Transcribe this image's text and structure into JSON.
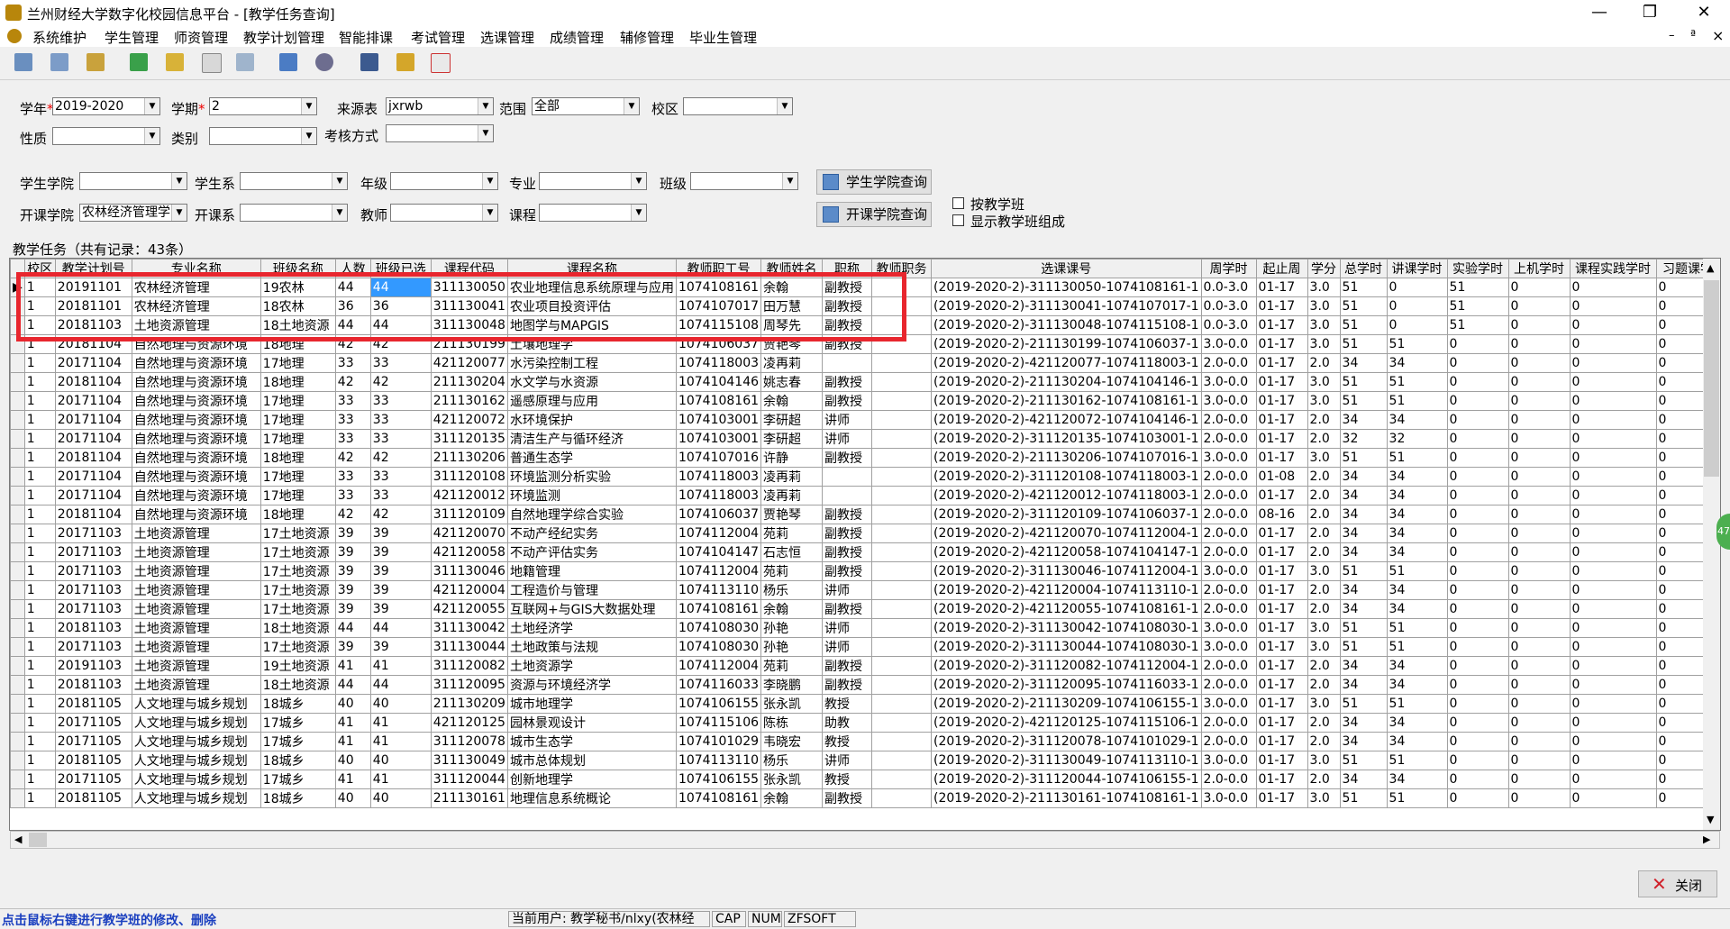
{
  "window": {
    "title": "兰州财经大学数字化校园信息平台 - [教学任务查询]",
    "min": "—",
    "max": "❐",
    "close": "✕"
  },
  "menu": [
    "系统维护",
    "学生管理",
    "师资管理",
    "教学计划管理",
    "智能排课",
    "考试管理",
    "选课管理",
    "成绩管理",
    "辅修管理",
    "毕业生管理"
  ],
  "mdi": {
    "min": "–",
    "restore": "ª",
    "close": "×"
  },
  "filters": {
    "xuenian_label": "学年",
    "xuenian_value": "2019-2020",
    "xueqi_label": "学期",
    "xueqi_value": "2",
    "laiyuan_label": "来源表",
    "laiyuan_value": "jxrwb",
    "fanwei_label": "范围",
    "fanwei_value": "全部",
    "xiaoqu_label": "校区",
    "xingzhi_label": "性质",
    "leibie_label": "类别",
    "kaohe_label": "考核方式",
    "xsxy_label": "学生学院",
    "xsx_label": "学生系",
    "nianji_label": "年级",
    "zhuanye_label": "专业",
    "banji_label": "班级",
    "kkxy_label": "开课学院",
    "kkxy_value": "农林经济管理学",
    "kkx_label": "开课系",
    "jiaoshi_label": "教师",
    "kecheng_label": "课程",
    "btn_student_query": "学生学院查询",
    "btn_course_query": "开课学院查询",
    "chk_by_class": "按教学班",
    "chk_show_compose": "显示教学班组成"
  },
  "grid": {
    "title": "教学任务（共有记录：43条）",
    "columns": [
      "校区",
      "教学计划号",
      "专业名称",
      "班级名称",
      "人数",
      "班级已选",
      "课程代码",
      "课程名称",
      "教师职工号",
      "教师姓名",
      "职称",
      "教师职务",
      "选课课号",
      "周学时",
      "起止周",
      "学分",
      "总学时",
      "讲课学时",
      "实验学时",
      "上机学时",
      "课程实践学时",
      "习题课学"
    ],
    "rows": [
      [
        "1",
        "20191101",
        "农林经济管理",
        "19农林",
        "44",
        "44",
        "311130050",
        "农业地理信息系统原理与应用",
        "1074108161",
        "余翰",
        "副教授",
        "",
        "(2019-2020-2)-311130050-1074108161-1",
        "0.0-3.0",
        "01-17",
        "3.0",
        "51",
        "0",
        "51",
        "0",
        "0",
        "0"
      ],
      [
        "1",
        "20181101",
        "农林经济管理",
        "18农林",
        "36",
        "36",
        "311130041",
        "农业项目投资评估",
        "1074107017",
        "田万慧",
        "副教授",
        "",
        "(2019-2020-2)-311130041-1074107017-1",
        "0.0-3.0",
        "01-17",
        "3.0",
        "51",
        "0",
        "51",
        "0",
        "0",
        "0"
      ],
      [
        "1",
        "20181103",
        "土地资源管理",
        "18土地资源",
        "44",
        "44",
        "311130048",
        "地图学与MAPGIS",
        "1074115108",
        "周琴先",
        "副教授",
        "",
        "(2019-2020-2)-311130048-1074115108-1",
        "0.0-3.0",
        "01-17",
        "3.0",
        "51",
        "0",
        "51",
        "0",
        "0",
        "0"
      ],
      [
        "1",
        "20181104",
        "自然地理与资源环境",
        "18地理",
        "42",
        "42",
        "211130199",
        "土壤地理学",
        "1074106037",
        "贾艳琴",
        "副教授",
        "",
        "(2019-2020-2)-211130199-1074106037-1",
        "3.0-0.0",
        "01-17",
        "3.0",
        "51",
        "51",
        "0",
        "0",
        "0",
        "0"
      ],
      [
        "1",
        "20171104",
        "自然地理与资源环境",
        "17地理",
        "33",
        "33",
        "421120077",
        "水污染控制工程",
        "1074118003",
        "凌再莉",
        "",
        "",
        "(2019-2020-2)-421120077-1074118003-1",
        "2.0-0.0",
        "01-17",
        "2.0",
        "34",
        "34",
        "0",
        "0",
        "0",
        "0"
      ],
      [
        "1",
        "20181104",
        "自然地理与资源环境",
        "18地理",
        "42",
        "42",
        "211130204",
        "水文学与水资源",
        "1074104146",
        "姚志春",
        "副教授",
        "",
        "(2019-2020-2)-211130204-1074104146-1",
        "3.0-0.0",
        "01-17",
        "3.0",
        "51",
        "51",
        "0",
        "0",
        "0",
        "0"
      ],
      [
        "1",
        "20171104",
        "自然地理与资源环境",
        "17地理",
        "33",
        "33",
        "211130162",
        "遥感原理与应用",
        "1074108161",
        "余翰",
        "副教授",
        "",
        "(2019-2020-2)-211130162-1074108161-1",
        "3.0-0.0",
        "01-17",
        "3.0",
        "51",
        "51",
        "0",
        "0",
        "0",
        "0"
      ],
      [
        "1",
        "20171104",
        "自然地理与资源环境",
        "17地理",
        "33",
        "33",
        "421120072",
        "水环境保护",
        "1074103001",
        "李研超",
        "讲师",
        "",
        "(2019-2020-2)-421120072-1074104146-1",
        "2.0-0.0",
        "01-17",
        "2.0",
        "34",
        "34",
        "0",
        "0",
        "0",
        "0"
      ],
      [
        "1",
        "20171104",
        "自然地理与资源环境",
        "17地理",
        "33",
        "33",
        "311120135",
        "清洁生产与循环经济",
        "1074103001",
        "李研超",
        "讲师",
        "",
        "(2019-2020-2)-311120135-1074103001-1",
        "2.0-0.0",
        "01-17",
        "2.0",
        "32",
        "32",
        "0",
        "0",
        "0",
        "0"
      ],
      [
        "1",
        "20181104",
        "自然地理与资源环境",
        "18地理",
        "42",
        "42",
        "211130206",
        "普通生态学",
        "1074107016",
        "许静",
        "副教授",
        "",
        "(2019-2020-2)-211130206-1074107016-1",
        "3.0-0.0",
        "01-17",
        "3.0",
        "51",
        "51",
        "0",
        "0",
        "0",
        "0"
      ],
      [
        "1",
        "20171104",
        "自然地理与资源环境",
        "17地理",
        "33",
        "33",
        "311120108",
        "环境监测分析实验",
        "1074118003",
        "凌再莉",
        "",
        "",
        "(2019-2020-2)-311120108-1074118003-1",
        "2.0-0.0",
        "01-08",
        "2.0",
        "34",
        "34",
        "0",
        "0",
        "0",
        "0"
      ],
      [
        "1",
        "20171104",
        "自然地理与资源环境",
        "17地理",
        "33",
        "33",
        "421120012",
        "环境监测",
        "1074118003",
        "凌再莉",
        "",
        "",
        "(2019-2020-2)-421120012-1074118003-1",
        "2.0-0.0",
        "01-17",
        "2.0",
        "34",
        "34",
        "0",
        "0",
        "0",
        "0"
      ],
      [
        "1",
        "20181104",
        "自然地理与资源环境",
        "18地理",
        "42",
        "42",
        "311120109",
        "自然地理学综合实验",
        "1074106037",
        "贾艳琴",
        "副教授",
        "",
        "(2019-2020-2)-311120109-1074106037-1",
        "2.0-0.0",
        "08-16",
        "2.0",
        "34",
        "34",
        "0",
        "0",
        "0",
        "0"
      ],
      [
        "1",
        "20171103",
        "土地资源管理",
        "17土地资源",
        "39",
        "39",
        "421120070",
        "不动产经纪实务",
        "1074112004",
        "苑莉",
        "副教授",
        "",
        "(2019-2020-2)-421120070-1074112004-1",
        "2.0-0.0",
        "01-17",
        "2.0",
        "34",
        "34",
        "0",
        "0",
        "0",
        "0"
      ],
      [
        "1",
        "20171103",
        "土地资源管理",
        "17土地资源",
        "39",
        "39",
        "421120058",
        "不动产评估实务",
        "1074104147",
        "石志恒",
        "副教授",
        "",
        "(2019-2020-2)-421120058-1074104147-1",
        "2.0-0.0",
        "01-17",
        "2.0",
        "34",
        "34",
        "0",
        "0",
        "0",
        "0"
      ],
      [
        "1",
        "20171103",
        "土地资源管理",
        "17土地资源",
        "39",
        "39",
        "311130046",
        "地籍管理",
        "1074112004",
        "苑莉",
        "副教授",
        "",
        "(2019-2020-2)-311130046-1074112004-1",
        "3.0-0.0",
        "01-17",
        "3.0",
        "51",
        "51",
        "0",
        "0",
        "0",
        "0"
      ],
      [
        "1",
        "20171103",
        "土地资源管理",
        "17土地资源",
        "39",
        "39",
        "421120004",
        "工程造价与管理",
        "1074113110",
        "杨乐",
        "讲师",
        "",
        "(2019-2020-2)-421120004-1074113110-1",
        "2.0-0.0",
        "01-17",
        "2.0",
        "34",
        "34",
        "0",
        "0",
        "0",
        "0"
      ],
      [
        "1",
        "20171103",
        "土地资源管理",
        "17土地资源",
        "39",
        "39",
        "421120055",
        "互联网+与GIS大数据处理",
        "1074108161",
        "余翰",
        "副教授",
        "",
        "(2019-2020-2)-421120055-1074108161-1",
        "2.0-0.0",
        "01-17",
        "2.0",
        "34",
        "34",
        "0",
        "0",
        "0",
        "0"
      ],
      [
        "1",
        "20181103",
        "土地资源管理",
        "18土地资源",
        "44",
        "44",
        "311130042",
        "土地经济学",
        "1074108030",
        "孙艳",
        "讲师",
        "",
        "(2019-2020-2)-311130042-1074108030-1",
        "3.0-0.0",
        "01-17",
        "3.0",
        "51",
        "51",
        "0",
        "0",
        "0",
        "0"
      ],
      [
        "1",
        "20171103",
        "土地资源管理",
        "17土地资源",
        "39",
        "39",
        "311130044",
        "土地政策与法规",
        "1074108030",
        "孙艳",
        "讲师",
        "",
        "(2019-2020-2)-311130044-1074108030-1",
        "3.0-0.0",
        "01-17",
        "3.0",
        "51",
        "51",
        "0",
        "0",
        "0",
        "0"
      ],
      [
        "1",
        "20191103",
        "土地资源管理",
        "19土地资源",
        "41",
        "41",
        "311120082",
        "土地资源学",
        "1074112004",
        "苑莉",
        "副教授",
        "",
        "(2019-2020-2)-311120082-1074112004-1",
        "2.0-0.0",
        "01-17",
        "2.0",
        "34",
        "34",
        "0",
        "0",
        "0",
        "0"
      ],
      [
        "1",
        "20181103",
        "土地资源管理",
        "18土地资源",
        "44",
        "44",
        "311120095",
        "资源与环境经济学",
        "1074116033",
        "李晓鹏",
        "副教授",
        "",
        "(2019-2020-2)-311120095-1074116033-1",
        "2.0-0.0",
        "01-17",
        "2.0",
        "34",
        "34",
        "0",
        "0",
        "0",
        "0"
      ],
      [
        "1",
        "20181105",
        "人文地理与城乡规划",
        "18城乡",
        "40",
        "40",
        "211130209",
        "城市地理学",
        "1074106155",
        "张永凯",
        "教授",
        "",
        "(2019-2020-2)-211130209-1074106155-1",
        "3.0-0.0",
        "01-17",
        "3.0",
        "51",
        "51",
        "0",
        "0",
        "0",
        "0"
      ],
      [
        "1",
        "20171105",
        "人文地理与城乡规划",
        "17城乡",
        "41",
        "41",
        "421120125",
        "园林景观设计",
        "1074115106",
        "陈栋",
        "助教",
        "",
        "(2019-2020-2)-421120125-1074115106-1",
        "2.0-0.0",
        "01-17",
        "2.0",
        "34",
        "34",
        "0",
        "0",
        "0",
        "0"
      ],
      [
        "1",
        "20171105",
        "人文地理与城乡规划",
        "17城乡",
        "41",
        "41",
        "311120078",
        "城市生态学",
        "1074101029",
        "韦晓宏",
        "教授",
        "",
        "(2019-2020-2)-311120078-1074101029-1",
        "2.0-0.0",
        "01-17",
        "2.0",
        "34",
        "34",
        "0",
        "0",
        "0",
        "0"
      ],
      [
        "1",
        "20181105",
        "人文地理与城乡规划",
        "18城乡",
        "40",
        "40",
        "311130049",
        "城市总体规划",
        "1074113110",
        "杨乐",
        "讲师",
        "",
        "(2019-2020-2)-311130049-1074113110-1",
        "3.0-0.0",
        "01-17",
        "3.0",
        "51",
        "51",
        "0",
        "0",
        "0",
        "0"
      ],
      [
        "1",
        "20171105",
        "人文地理与城乡规划",
        "17城乡",
        "41",
        "41",
        "311120044",
        "创新地理学",
        "1074106155",
        "张永凯",
        "教授",
        "",
        "(2019-2020-2)-311120044-1074106155-1",
        "2.0-0.0",
        "01-17",
        "2.0",
        "34",
        "34",
        "0",
        "0",
        "0",
        "0"
      ],
      [
        "1",
        "20181105",
        "人文地理与城乡规划",
        "18城乡",
        "40",
        "40",
        "211130161",
        "地理信息系统概论",
        "1074108161",
        "余翰",
        "副教授",
        "",
        "(2019-2020-2)-211130161-1074108161-1",
        "3.0-0.0",
        "01-17",
        "3.0",
        "51",
        "51",
        "0",
        "0",
        "0",
        "0"
      ]
    ]
  },
  "close_button": "关闭",
  "status": {
    "hint": "点击鼠标右键进行教学班的修改、删除",
    "user": "当前用户: 教学秘书/nlxy(农林经",
    "cap": "CAP",
    "num": "NUM",
    "brand": "ZFSOFT"
  },
  "side_badge": "47"
}
